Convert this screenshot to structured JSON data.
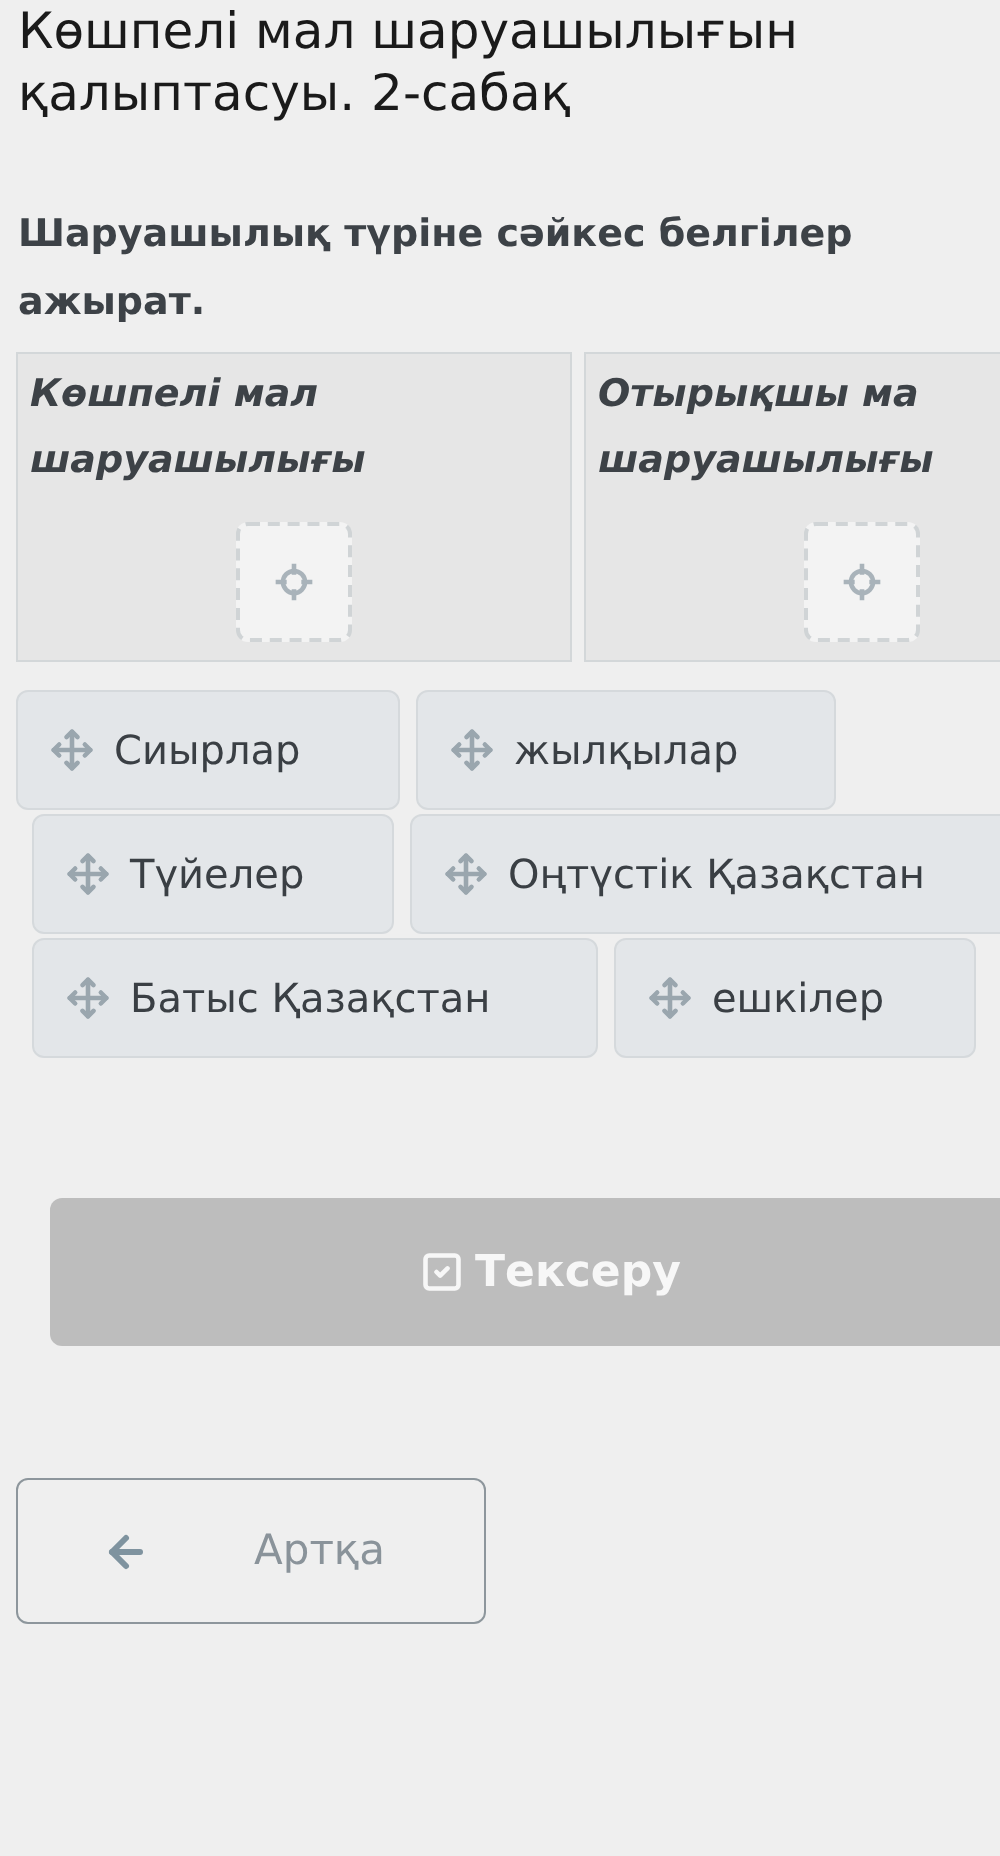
{
  "title": "Көшпелі мал шаруашылығын\nқалыптасуы. 2-сабақ",
  "instruction": "Шаруашылық түріне сәйкес белгілер\nажырат.",
  "categories": [
    {
      "label": "Көшпелі мал\nшаруашылығы"
    },
    {
      "label": "Отырықшы ма\nшаруашылығы"
    }
  ],
  "item_rows": [
    [
      "Сиырлар",
      "жылқылар"
    ],
    [
      "Түйелер",
      "Оңтүстік Қазақстан"
    ],
    [
      "Батыс Қазақстан",
      "ешкілер"
    ]
  ],
  "check_button": {
    "label": "Тексеру",
    "disabled": true
  },
  "back_button": {
    "label": "Артқа"
  }
}
